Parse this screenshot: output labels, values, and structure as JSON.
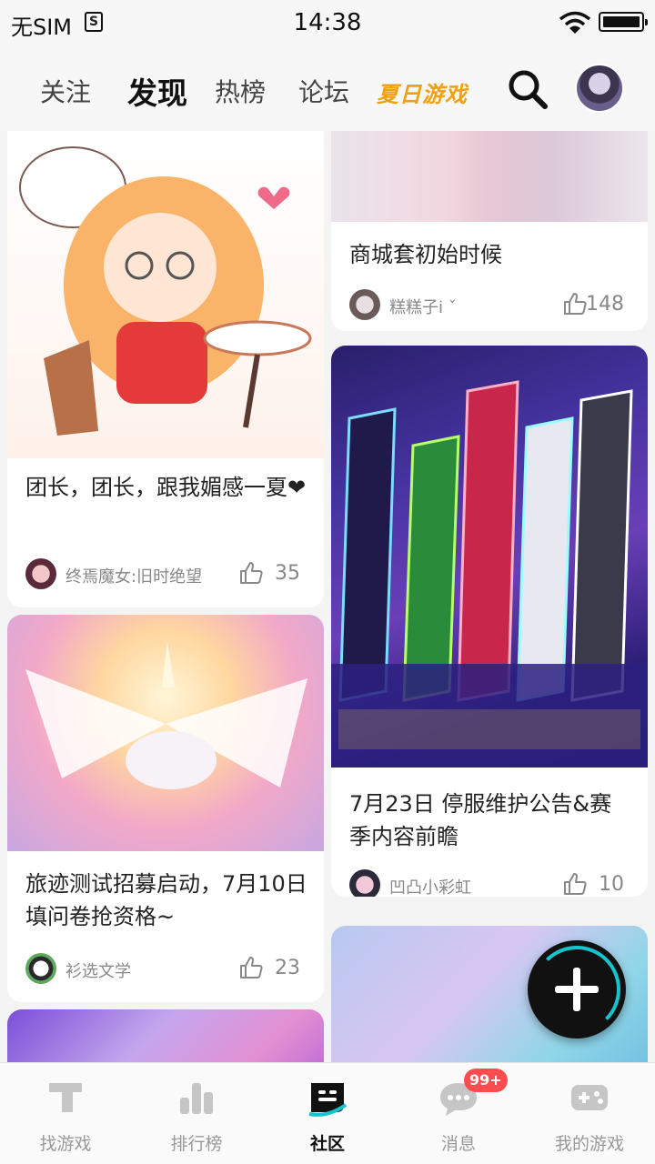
{
  "status_bar": {
    "carrier": "无SIM",
    "sim_label": "S",
    "time": "14:38"
  },
  "top_nav": {
    "tabs": [
      {
        "label": "关注"
      },
      {
        "label": "发现",
        "active": true
      },
      {
        "label": "热榜"
      },
      {
        "label": "论坛"
      },
      {
        "label": "夏日游戏"
      }
    ]
  },
  "feed": {
    "posts": [
      {
        "title": "团长，团长，跟我媚感一夏❤",
        "author": "终焉魔女:旧时绝望",
        "likes": "35"
      },
      {
        "title": "商城套初始时候",
        "author": "糕糕子i ˇ",
        "likes": "148"
      },
      {
        "title": "7月23日 停服维护公告&赛季内容前瞻",
        "author": "凹凸小彩虹",
        "likes": "10"
      },
      {
        "title": "旅迹测试招募启动，7月10日填问卷抢资格~",
        "author": "衫选文学",
        "likes": "23"
      }
    ]
  },
  "bottom_nav": {
    "items": [
      {
        "label": "找游戏"
      },
      {
        "label": "排行榜"
      },
      {
        "label": "社区",
        "active": true
      },
      {
        "label": "消息",
        "badge": "99+"
      },
      {
        "label": "我的游戏"
      }
    ]
  },
  "colors": {
    "accent": "#15c5ce",
    "summer": "#f0a010",
    "badge": "#ff4d4f"
  }
}
